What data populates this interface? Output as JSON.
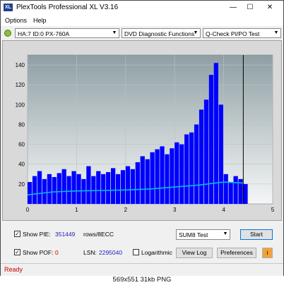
{
  "window": {
    "title": "PlexTools Professional XL V3.16"
  },
  "menu": {
    "options": "Options",
    "help": "Help"
  },
  "toolbar": {
    "drive": "HA:7 ID:0  PX-760A",
    "function": "DVD Diagnostic Functions",
    "test": "Q-Check PI/PO Test"
  },
  "chart_data": {
    "type": "bar",
    "x_ticks": [
      "0",
      "1",
      "2",
      "3",
      "4",
      "5"
    ],
    "y_ticks": [
      "20",
      "40",
      "60",
      "80",
      "100",
      "120",
      "140"
    ],
    "xlim": [
      0,
      5
    ],
    "ylim": [
      0,
      150
    ],
    "grid": true,
    "end_marker_x": 4.4,
    "series": [
      {
        "color": "#0000ff",
        "x": [
          0,
          0.1,
          0.2,
          0.3,
          0.4,
          0.5,
          0.6,
          0.7,
          0.8,
          0.9,
          1.0,
          1.1,
          1.2,
          1.3,
          1.4,
          1.5,
          1.6,
          1.7,
          1.8,
          1.9,
          2.0,
          2.1,
          2.2,
          2.3,
          2.4,
          2.5,
          2.6,
          2.7,
          2.8,
          2.9,
          3.0,
          3.1,
          3.2,
          3.3,
          3.4,
          3.5,
          3.6,
          3.7,
          3.8,
          3.9,
          4.0,
          4.1,
          4.2,
          4.3,
          4.4
        ],
        "values": [
          22,
          28,
          33,
          25,
          30,
          27,
          31,
          35,
          28,
          33,
          30,
          25,
          38,
          28,
          33,
          30,
          32,
          36,
          30,
          34,
          38,
          35,
          42,
          48,
          45,
          52,
          55,
          58,
          50,
          56,
          62,
          60,
          70,
          72,
          80,
          95,
          105,
          130,
          142,
          100,
          30,
          22,
          28,
          25,
          20
        ]
      },
      {
        "color": "#00bfe0",
        "x": [
          0,
          0.5,
          1.0,
          1.5,
          2.0,
          2.5,
          3.0,
          3.5,
          4.0,
          4.4
        ],
        "values": [
          9,
          12,
          13,
          13.5,
          14,
          15,
          17,
          19,
          22,
          21
        ]
      }
    ]
  },
  "stats": {
    "show_pie_label": "Show PIE:",
    "pie_value": "351449",
    "pie_unit": "rows/8ECC",
    "show_pof_label": "Show POF:",
    "pof_value": "0",
    "lsn_label": "LSN:",
    "lsn_value": "2295040",
    "logarithmic_label": "Logarithmic"
  },
  "controls": {
    "test_select": "SUM8 Test",
    "start": "Start",
    "view_log": "View Log",
    "preferences": "Preferences"
  },
  "status": {
    "text": "Ready"
  },
  "caption": "569x551  31kb  PNG",
  "colors": {
    "bar": "#0000ff",
    "avg_line": "#00bfe0",
    "status": "#d00000",
    "value_text": "#1f1fbf"
  }
}
